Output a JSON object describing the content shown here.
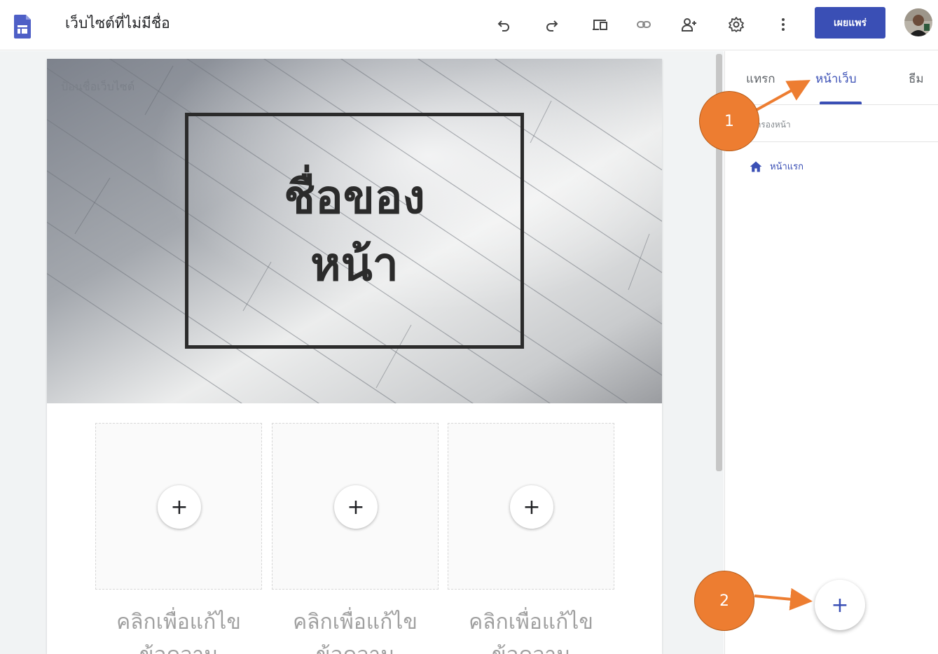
{
  "header": {
    "title": "เว็บไซต์ที่ไม่มีชื่อ",
    "publish_label": "เผยแพร่",
    "icons": [
      "sites-logo-icon",
      "undo-icon",
      "redo-icon",
      "preview-icon",
      "link-icon",
      "share-icon",
      "settings-gear-icon",
      "more-vert-icon",
      "avatar"
    ]
  },
  "canvas": {
    "site_name_placeholder": "ป้อนชื่อเว็บไซต์",
    "page_title_line1": "ชื่อของ",
    "page_title_line2": "หน้า",
    "placeholders": [
      {
        "add_icon": "+",
        "text_line1": "คลิกเพื่อแก้ไข",
        "text_line2": "ข้อความ"
      },
      {
        "add_icon": "+",
        "text_line1": "คลิกเพื่อแก้ไข",
        "text_line2": "ข้อความ"
      },
      {
        "add_icon": "+",
        "text_line1": "คลิกเพื่อแก้ไข",
        "text_line2": "ข้อความ"
      }
    ]
  },
  "side_panel": {
    "tabs": [
      {
        "label": "แทรก",
        "active": false
      },
      {
        "label": "หน้าเว็บ",
        "active": true
      },
      {
        "label": "ธีม",
        "active": false
      }
    ],
    "filter_placeholder": "กรองหน้า",
    "pages": [
      {
        "label": "หน้าแรก",
        "icon": "home-icon"
      }
    ],
    "fab_label": "+"
  },
  "annotations": {
    "markers": [
      {
        "label": "1"
      },
      {
        "label": "2"
      }
    ]
  },
  "colors": {
    "accent": "#3a4fb5",
    "marker": "#ed7d31",
    "title_border": "#2b2b2b"
  }
}
